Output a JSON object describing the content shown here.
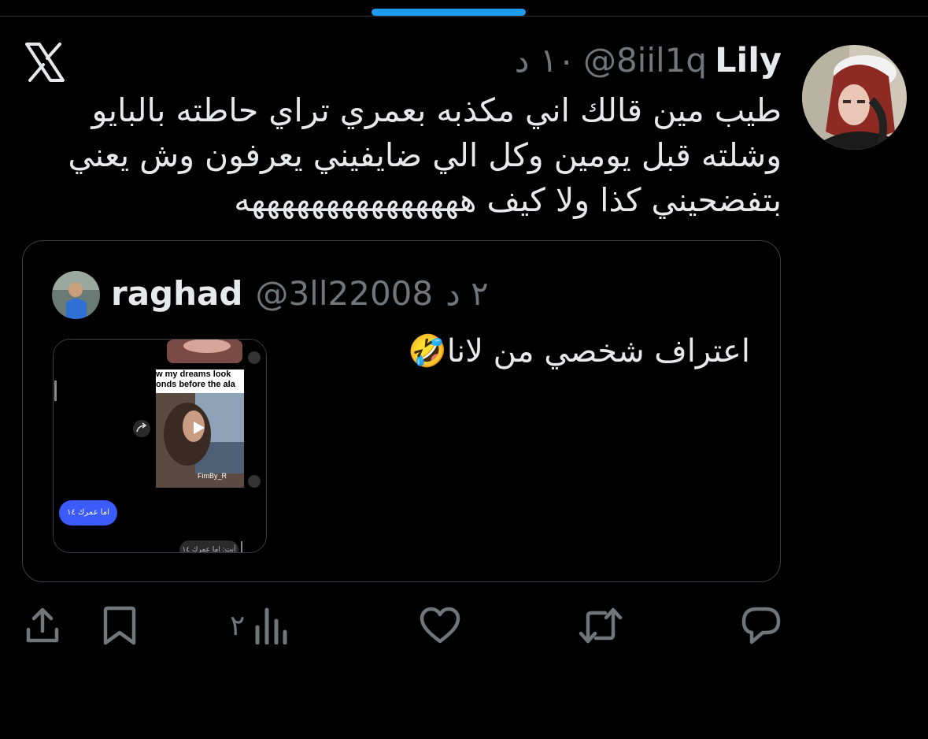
{
  "tweet": {
    "name": "Lily",
    "handle": "@8iil1q",
    "time": "١٠ د",
    "lines": [
      "طيب مين قالك اني مكذبه بعمري تراي حاطته بالبايو",
      "وشلته قبل يومين وكل الي ضايفيني يعرفون وش يعني",
      "بتفضحيني كذا ولا كيف هههههههههههههههه"
    ]
  },
  "quote": {
    "name": "raghad",
    "handle": "@3ll22008",
    "time": "٢ د",
    "text": "اعتراف شخصي من لانا",
    "emoji": "🤣",
    "media": {
      "caption_line1": "w my dreams look",
      "caption_line2": "onds before the ala",
      "video_user": "FimBy_R",
      "bubble_text": "اما عمرك ١٤",
      "reply_text": "أنت: اما عمرك ١٤"
    }
  },
  "actions": {
    "views": "٢",
    "icons": [
      "share-icon",
      "bookmark-icon",
      "views-icon",
      "like-icon",
      "retweet-icon",
      "reply-icon"
    ]
  },
  "colors": {
    "background": "#000000",
    "text": "#e7e9ea",
    "muted": "#71767b",
    "accent": "#1d9bf0",
    "border": "#3a3f44"
  }
}
